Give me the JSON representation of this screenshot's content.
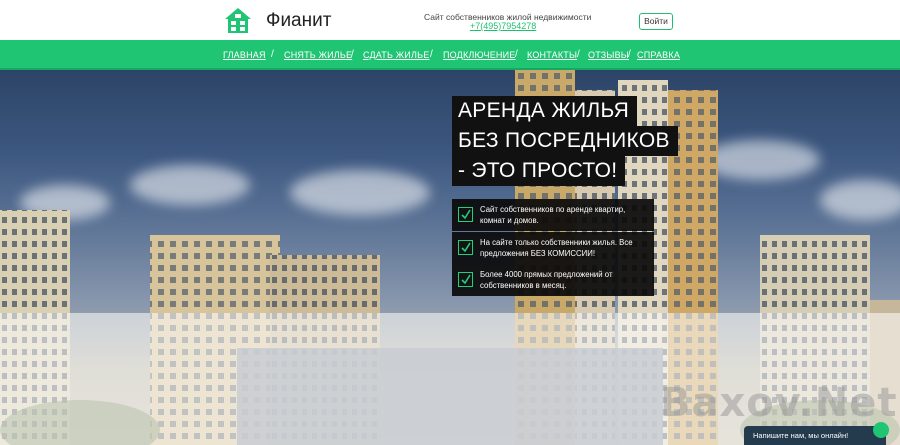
{
  "header": {
    "brand": "Фианит",
    "tagline": "Сайт собственников жилой недвижимости",
    "phone": "+7(495)7954278",
    "login_label": "Войти"
  },
  "nav": {
    "items": [
      {
        "label": "ГЛАВНАЯ"
      },
      {
        "label": "СНЯТЬ ЖИЛЬЕ"
      },
      {
        "label": "СДАТЬ ЖИЛЬЕ"
      },
      {
        "label": "ПОДКЛЮЧЕНИЕ"
      },
      {
        "label": "КОНТАКТЫ"
      },
      {
        "label": "ОТЗЫВЫ"
      },
      {
        "label": "СПРАВКА"
      }
    ],
    "separator": "/"
  },
  "hero": {
    "headline": [
      "АРЕНДА ЖИЛЬЯ",
      "БЕЗ ПОСРЕДНИКОВ",
      "- ЭТО ПРОСТО!"
    ],
    "features": [
      {
        "text": "Сайт собственников по аренде квартир, комнат и домов."
      },
      {
        "text": "На сайте только собственники жилья. Все предложения БЕЗ КОМИССИИ!"
      },
      {
        "text": "Более 4000 прямых предложений от собственников в месяц."
      }
    ]
  },
  "watermark": "Baxov.Net",
  "chat": {
    "label": "Напишите нам, мы онлайн!"
  },
  "colors": {
    "accent": "#1fc573",
    "dark": "#111111",
    "chat_bg": "#243a4d"
  }
}
